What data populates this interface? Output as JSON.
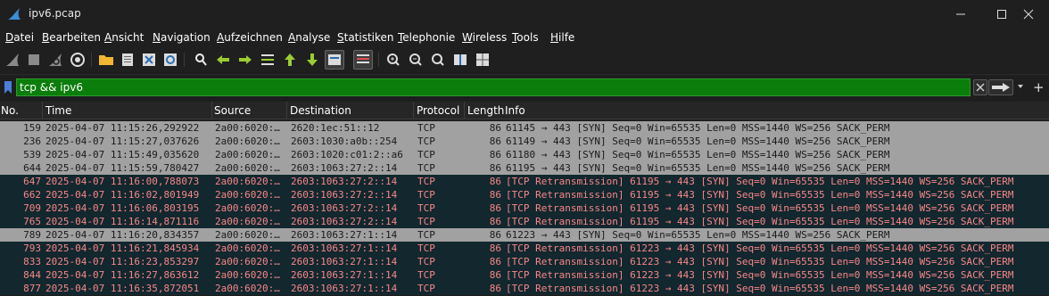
{
  "window": {
    "title": "ipv6.pcap",
    "accent_colors": {
      "filter_bg": "#0a7d0a",
      "normal_row_bg": "#a1a1a1",
      "bad_row_bg": "#12272e",
      "bad_row_fg": "#f78787"
    }
  },
  "menu": [
    {
      "label": "Datei"
    },
    {
      "label": "Bearbeiten"
    },
    {
      "label": "Ansicht"
    },
    {
      "label": "Navigation"
    },
    {
      "label": "Aufzeichnen"
    },
    {
      "label": "Analyse"
    },
    {
      "label": "Statistiken"
    },
    {
      "label": "Telephonie"
    },
    {
      "label": "Wireless"
    },
    {
      "label": "Tools"
    },
    {
      "label": "Hilfe"
    }
  ],
  "toolbar": {
    "icons": [
      "shark-fin-start-icon",
      "stop-icon",
      "shark-fin-restart-icon",
      "options-gear-icon",
      "folder-open-icon",
      "file-icon",
      "close-file-icon",
      "reload-icon",
      "find-icon",
      "back-arrow-icon",
      "forward-arrow-icon",
      "go-to-packet-icon",
      "go-first-icon",
      "go-last-icon",
      "autoscroll-icon",
      "colorize-icon",
      "zoom-in-icon",
      "zoom-out-icon",
      "zoom-normal-icon",
      "resize-columns-icon",
      "layout-icon"
    ]
  },
  "filter": {
    "value": "tcp && ipv6"
  },
  "columns": [
    "No.",
    "Time",
    "Source",
    "Destination",
    "Protocol",
    "Length",
    "Info"
  ],
  "packets": [
    {
      "no": "159",
      "time": "2025-04-07 11:15:26,292922",
      "src": "2a00:6020:…",
      "dst": "2620:1ec:51::12",
      "proto": "TCP",
      "len": "86",
      "info": "61145 → 443 [SYN] Seq=0 Win=65535 Len=0 MSS=1440 WS=256 SACK_PERM"
    },
    {
      "no": "236",
      "time": "2025-04-07 11:15:27,037626",
      "src": "2a00:6020:…",
      "dst": "2603:1030:a0b::254",
      "proto": "TCP",
      "len": "86",
      "info": "61149 → 443 [SYN] Seq=0 Win=65535 Len=0 MSS=1440 WS=256 SACK_PERM"
    },
    {
      "no": "539",
      "time": "2025-04-07 11:15:49,035620",
      "src": "2a00:6020:…",
      "dst": "2603:1020:c01:2::a6",
      "proto": "TCP",
      "len": "86",
      "info": "61180 → 443 [SYN] Seq=0 Win=65535 Len=0 MSS=1440 WS=256 SACK_PERM"
    },
    {
      "no": "644",
      "time": "2025-04-07 11:15:59,780427",
      "src": "2a00:6020:…",
      "dst": "2603:1063:27:2::14",
      "proto": "TCP",
      "len": "86",
      "info": "61195 → 443 [SYN] Seq=0 Win=65535 Len=0 MSS=1440 WS=256 SACK_PERM"
    },
    {
      "no": "647",
      "time": "2025-04-07 11:16:00,788073",
      "src": "2a00:6020:…",
      "dst": "2603:1063:27:2::14",
      "proto": "TCP",
      "len": "86",
      "info": "[TCP Retransmission] 61195 → 443 [SYN] Seq=0 Win=65535 Len=0 MSS=1440 WS=256 SACK_PERM"
    },
    {
      "no": "662",
      "time": "2025-04-07 11:16:02,801949",
      "src": "2a00:6020:…",
      "dst": "2603:1063:27:2::14",
      "proto": "TCP",
      "len": "86",
      "info": "[TCP Retransmission] 61195 → 443 [SYN] Seq=0 Win=65535 Len=0 MSS=1440 WS=256 SACK_PERM"
    },
    {
      "no": "709",
      "time": "2025-04-07 11:16:06,803195",
      "src": "2a00:6020:…",
      "dst": "2603:1063:27:2::14",
      "proto": "TCP",
      "len": "86",
      "info": "[TCP Retransmission] 61195 → 443 [SYN] Seq=0 Win=65535 Len=0 MSS=1440 WS=256 SACK_PERM"
    },
    {
      "no": "765",
      "time": "2025-04-07 11:16:14,871116",
      "src": "2a00:6020:…",
      "dst": "2603:1063:27:2::14",
      "proto": "TCP",
      "len": "86",
      "info": "[TCP Retransmission] 61195 → 443 [SYN] Seq=0 Win=65535 Len=0 MSS=1440 WS=256 SACK_PERM"
    },
    {
      "no": "789",
      "time": "2025-04-07 11:16:20,834357",
      "src": "2a00:6020:…",
      "dst": "2603:1063:27:1::14",
      "proto": "TCP",
      "len": "86",
      "info": "61223 → 443 [SYN] Seq=0 Win=65535 Len=0 MSS=1440 WS=256 SACK_PERM"
    },
    {
      "no": "793",
      "time": "2025-04-07 11:16:21,845934",
      "src": "2a00:6020:…",
      "dst": "2603:1063:27:1::14",
      "proto": "TCP",
      "len": "86",
      "info": "[TCP Retransmission] 61223 → 443 [SYN] Seq=0 Win=65535 Len=0 MSS=1440 WS=256 SACK_PERM"
    },
    {
      "no": "833",
      "time": "2025-04-07 11:16:23,853297",
      "src": "2a00:6020:…",
      "dst": "2603:1063:27:1::14",
      "proto": "TCP",
      "len": "86",
      "info": "[TCP Retransmission] 61223 → 443 [SYN] Seq=0 Win=65535 Len=0 MSS=1440 WS=256 SACK_PERM"
    },
    {
      "no": "844",
      "time": "2025-04-07 11:16:27,863612",
      "src": "2a00:6020:…",
      "dst": "2603:1063:27:1::14",
      "proto": "TCP",
      "len": "86",
      "info": "[TCP Retransmission] 61223 → 443 [SYN] Seq=0 Win=65535 Len=0 MSS=1440 WS=256 SACK_PERM"
    },
    {
      "no": "877",
      "time": "2025-04-07 11:16:35,872051",
      "src": "2a00:6020:…",
      "dst": "2603:1063:27:1::14",
      "proto": "TCP",
      "len": "86",
      "info": "[TCP Retransmission] 61223 → 443 [SYN] Seq=0 Win=65535 Len=0 MSS=1440 WS=256 SACK_PERM"
    }
  ]
}
